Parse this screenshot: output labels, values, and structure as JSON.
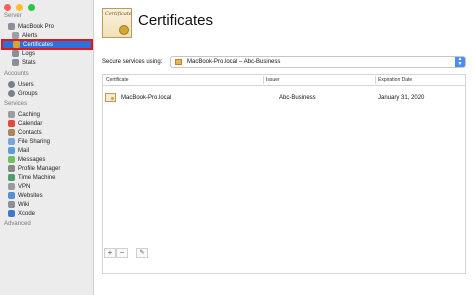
{
  "window": {
    "traffic_lights": [
      "#fe5f57",
      "#febc2e",
      "#28c840"
    ]
  },
  "sidebar": {
    "sections": [
      {
        "title": "Server",
        "items": [
          {
            "label": "MacBook Pro",
            "icon": "server-icon",
            "color": "#8a8f99"
          },
          {
            "label": "Alerts",
            "icon": "alerts-icon",
            "color": "#9aa0a8"
          },
          {
            "label": "Certificates",
            "icon": "certificate-icon",
            "color": "#d4a43a",
            "selected": true
          },
          {
            "label": "Logs",
            "icon": "logs-icon",
            "color": "#8a8f99"
          },
          {
            "label": "Stats",
            "icon": "stats-icon",
            "color": "#8a8f99"
          }
        ]
      },
      {
        "title": "Accounts",
        "items": [
          {
            "label": "Users",
            "icon": "users-icon",
            "color": "#7b8088"
          },
          {
            "label": "Groups",
            "icon": "groups-icon",
            "color": "#7b8088"
          }
        ]
      },
      {
        "title": "Services",
        "items": [
          {
            "label": "Caching",
            "icon": "caching-icon",
            "color": "#9b9ba0"
          },
          {
            "label": "Calendar",
            "icon": "calendar-icon",
            "color": "#e24b3c"
          },
          {
            "label": "Contacts",
            "icon": "contacts-icon",
            "color": "#a8865e"
          },
          {
            "label": "File Sharing",
            "icon": "file-sharing-icon",
            "color": "#7aa5d8"
          },
          {
            "label": "Mail",
            "icon": "mail-icon",
            "color": "#5b9bdf"
          },
          {
            "label": "Messages",
            "icon": "messages-icon",
            "color": "#6cc35c"
          },
          {
            "label": "Profile Manager",
            "icon": "profile-manager-icon",
            "color": "#888888"
          },
          {
            "label": "Time Machine",
            "icon": "time-machine-icon",
            "color": "#4f9d6e"
          },
          {
            "label": "VPN",
            "icon": "vpn-icon",
            "color": "#9a9aa0"
          },
          {
            "label": "Websites",
            "icon": "websites-icon",
            "color": "#5a8fd6"
          },
          {
            "label": "Wiki",
            "icon": "wiki-icon",
            "color": "#8a8f99"
          },
          {
            "label": "Xcode",
            "icon": "xcode-icon",
            "color": "#3e78c9"
          }
        ]
      },
      {
        "title": "Advanced",
        "items": []
      }
    ]
  },
  "main": {
    "title": "Certificates",
    "cert_art_text": "Certificate",
    "secure_label": "Secure services using:",
    "secure_value": "MacBook-Pro.local – Abc-Business",
    "columns": [
      "Certificate",
      "Issuer",
      "Expiration Date"
    ],
    "rows": [
      {
        "certificate": "MacBook-Pro.local",
        "issuer": "Abc-Business",
        "expiration": "January 31, 2020"
      }
    ],
    "footer": {
      "add": "+",
      "remove": "−",
      "edit": "✎"
    }
  }
}
